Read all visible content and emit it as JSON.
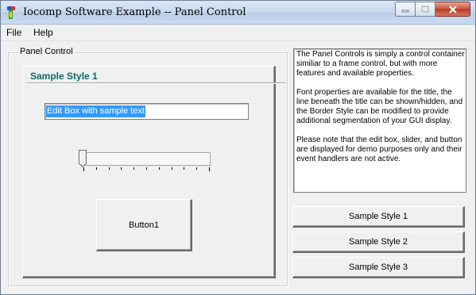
{
  "window": {
    "title": "Iocomp Software Example -- Panel Control"
  },
  "menu": {
    "items": [
      {
        "label": "File"
      },
      {
        "label": "Help"
      }
    ]
  },
  "group": {
    "label": "Panel Control"
  },
  "panel": {
    "title": "Sample Style 1",
    "edit_text": "Edit Box with sample text",
    "slider_value": 0,
    "tick_count": 11,
    "button_label": "Button1"
  },
  "info": {
    "paragraphs": [
      "The Panel Controls is simply a control container similiar to a frame control, but with more features and available properties.",
      "Font properties are available for the title, the line beneath the title can be shown/hidden, and the Border Style can be modified to provide additional segmentation of your GUI display.",
      "Please note that the edit box, slider, and button are displayed for demo purposes only and their event handlers are not active."
    ]
  },
  "side_buttons": [
    {
      "label": "Sample Style 1"
    },
    {
      "label": "Sample Style 2"
    },
    {
      "label": "Sample Style 3"
    }
  ],
  "colors": {
    "panel_title": "#0f6a6a",
    "selection": "#3399ff",
    "close_button": "#c7513b"
  }
}
